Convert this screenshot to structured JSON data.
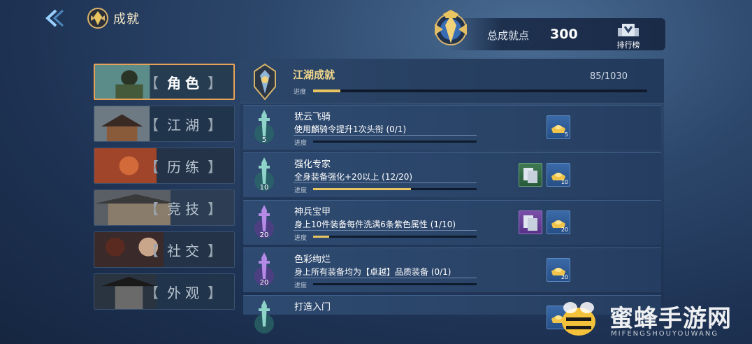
{
  "header": {
    "title": "成就",
    "total_label": "总成就点",
    "total_value": "300",
    "rank_label": "排行榜"
  },
  "tabs": [
    {
      "label": "角色",
      "active": true
    },
    {
      "label": "江湖",
      "active": false
    },
    {
      "label": "历练",
      "active": false
    },
    {
      "label": "竞技",
      "active": false
    },
    {
      "label": "社交",
      "active": false
    },
    {
      "label": "外观",
      "active": false
    }
  ],
  "category": {
    "title": "江湖成就",
    "count": "85/1030",
    "progress_label": "进度",
    "progress": 0.0825
  },
  "achievements": [
    {
      "name": "犹云飞骑",
      "desc": "使用麟骑令提升1次头衔 (0/1)",
      "level": "5",
      "progress_label": "进度",
      "progress": 0.0,
      "rewards": [
        {
          "type": "gold",
          "count": "5"
        }
      ],
      "sword_color": "teal"
    },
    {
      "name": "强化专家",
      "desc": "全身装备强化+20以上 (12/20)",
      "level": "10",
      "progress_label": "进度",
      "progress": 0.6,
      "rewards": [
        {
          "type": "green",
          "count": ""
        },
        {
          "type": "gold",
          "count": "10"
        }
      ],
      "sword_color": "teal"
    },
    {
      "name": "神兵宝甲",
      "desc": "身上10件装备每件洗满6条紫色属性 (1/10)",
      "level": "20",
      "progress_label": "进度",
      "progress": 0.1,
      "rewards": [
        {
          "type": "purple",
          "count": ""
        },
        {
          "type": "gold",
          "count": "20"
        }
      ],
      "sword_color": "purple"
    },
    {
      "name": "色彩绚烂",
      "desc": "身上所有装备均为【卓越】品质装备 (0/1)",
      "level": "20",
      "progress_label": "进度",
      "progress": 0.0,
      "rewards": [
        {
          "type": "gold",
          "count": "20"
        }
      ],
      "sword_color": "purple"
    },
    {
      "name": "打造入门",
      "desc": "",
      "level": "",
      "progress_label": "",
      "progress": 0.0,
      "rewards": [
        {
          "type": "gold",
          "count": ""
        }
      ],
      "sword_color": "teal"
    }
  ],
  "watermark": {
    "text": "蜜蜂手游网",
    "sub": "MIFENGSHOUYOUWANG"
  },
  "colors": {
    "accent_gold": "#e9c561",
    "tab_active_border": "#e8a257",
    "panel": "#2c4669"
  }
}
